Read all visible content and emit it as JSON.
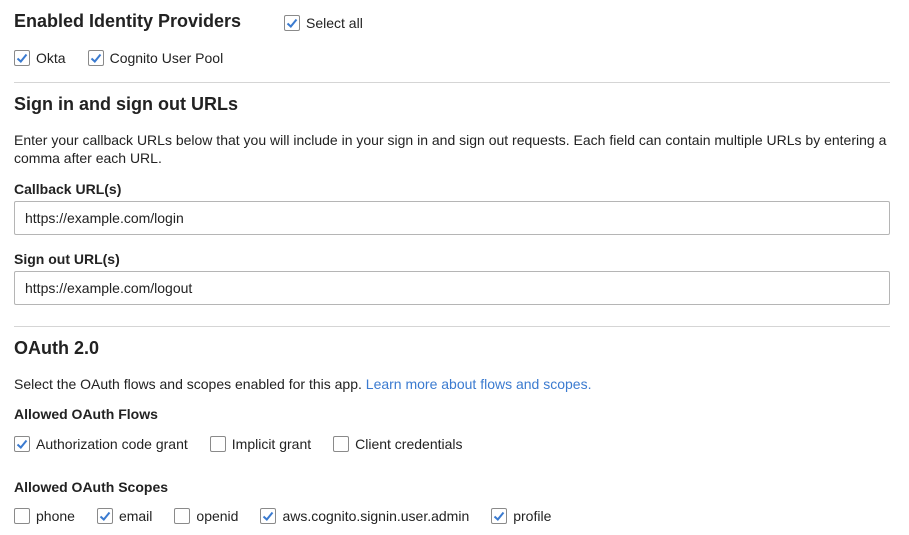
{
  "identity_providers": {
    "title": "Enabled Identity Providers",
    "select_all": {
      "label": "Select all",
      "checked": true
    },
    "providers": [
      {
        "label": "Okta",
        "checked": true
      },
      {
        "label": "Cognito User Pool",
        "checked": true
      }
    ]
  },
  "urls": {
    "title": "Sign in and sign out URLs",
    "description": "Enter your callback URLs below that you will include in your sign in and sign out requests. Each field can contain multiple URLs by entering a comma after each URL.",
    "callback_label": "Callback URL(s)",
    "callback_value": "https://example.com/login",
    "signout_label": "Sign out URL(s)",
    "signout_value": "https://example.com/logout"
  },
  "oauth": {
    "title": "OAuth 2.0",
    "description": "Select the OAuth flows and scopes enabled for this app.",
    "learn_more": "Learn more about flows and scopes.",
    "flows_label": "Allowed OAuth Flows",
    "flows": [
      {
        "label": "Authorization code grant",
        "checked": true
      },
      {
        "label": "Implicit grant",
        "checked": false
      },
      {
        "label": "Client credentials",
        "checked": false
      }
    ],
    "scopes_label": "Allowed OAuth Scopes",
    "scopes": [
      {
        "label": "phone",
        "checked": false
      },
      {
        "label": "email",
        "checked": true
      },
      {
        "label": "openid",
        "checked": false
      },
      {
        "label": "aws.cognito.signin.user.admin",
        "checked": true
      },
      {
        "label": "profile",
        "checked": true
      }
    ]
  },
  "colors": {
    "checkmark": "#3b7bd0",
    "link": "#3b7bd0",
    "divider": "#d5d5d5"
  }
}
